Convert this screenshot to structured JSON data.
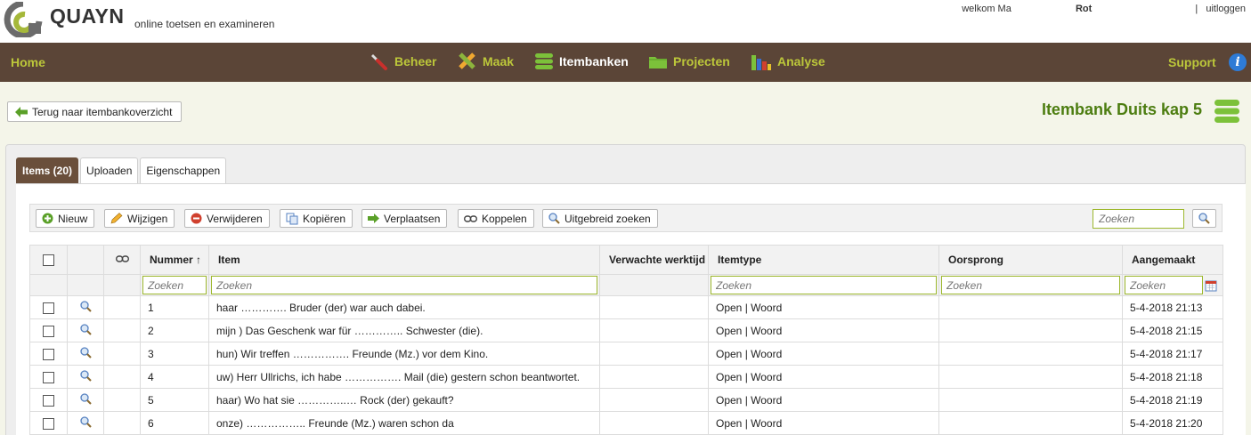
{
  "brand": {
    "name": "QUAYN",
    "tagline": "online toetsen en examineren"
  },
  "user": {
    "welcome": "welkom Ma",
    "name": "Rot",
    "logout": "uitloggen"
  },
  "nav": {
    "home": "Home",
    "items": [
      {
        "label": "Beheer",
        "icon": "wrench-icon"
      },
      {
        "label": "Maak",
        "icon": "pencil-ruler-icon"
      },
      {
        "label": "Itembanken",
        "icon": "itembank-stack-icon"
      },
      {
        "label": "Projecten",
        "icon": "folder-icon"
      },
      {
        "label": "Analyse",
        "icon": "bar-chart-icon"
      }
    ],
    "active": "Itembanken",
    "support": "Support"
  },
  "back_button": "Terug naar itembankoverzicht",
  "bank_title": "Itembank Duits kap 5",
  "tabs": [
    "Items (20)",
    "Uploaden",
    "Eigenschappen"
  ],
  "toolbar": {
    "new": "Nieuw",
    "edit": "Wijzigen",
    "delete": "Verwijderen",
    "copy": "Kopiëren",
    "move": "Verplaatsen",
    "link": "Koppelen",
    "advanced_search": "Uitgebreid zoeken",
    "search_placeholder": "Zoeken"
  },
  "grid": {
    "columns": {
      "number": "Nummer",
      "item": "Item",
      "expected_time": "Verwachte werktijd",
      "item_type": "Itemtype",
      "origin": "Oorsprong",
      "created": "Aangemaakt"
    },
    "sort_arrow": "↑",
    "filter_placeholder": "Zoeken",
    "rows": [
      {
        "number": "1",
        "item": "haar …………. Bruder (der) war auch dabei.",
        "time": "",
        "type": "Open | Woord",
        "origin": "",
        "created": "5-4-2018 21:13"
      },
      {
        "number": "2",
        "item": "mijn ) Das Geschenk war für ………….. Schwester (die).",
        "time": "",
        "type": "Open | Woord",
        "origin": "",
        "created": "5-4-2018 21:15"
      },
      {
        "number": "3",
        "item": "hun) Wir treffen ……………. Freunde (Mz.) vor dem Kino.",
        "time": "",
        "type": "Open | Woord",
        "origin": "",
        "created": "5-4-2018 21:17"
      },
      {
        "number": "4",
        "item": "uw) Herr Ullrichs, ich habe ……………. Mail (die) gestern schon beantwortet.",
        "time": "",
        "type": "Open | Woord",
        "origin": "",
        "created": "5-4-2018 21:18"
      },
      {
        "number": "5",
        "item": "haar) Wo hat sie …………..… Rock (der) gekauft?",
        "time": "",
        "type": "Open | Woord",
        "origin": "",
        "created": "5-4-2018 21:19"
      },
      {
        "number": "6",
        "item": "onze) …………….. Freunde (Mz.) waren schon da",
        "time": "",
        "type": "Open | Woord",
        "origin": "",
        "created": "5-4-2018 21:20"
      }
    ]
  },
  "colors": {
    "nav_bg": "#5b4537",
    "nav_text": "#bcc73a",
    "title_green": "#4c7d10",
    "tab_active": "#6a4f3b"
  }
}
